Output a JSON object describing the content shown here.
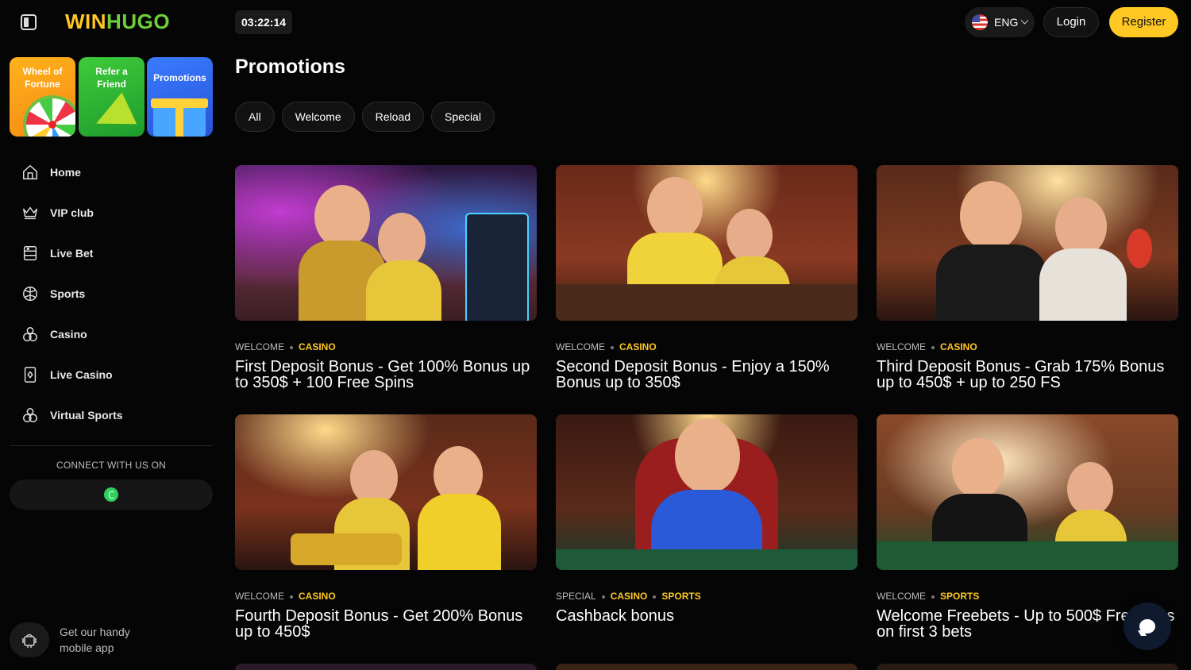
{
  "brand": {
    "logo_part1": "WIN",
    "logo_part2": "HUGO"
  },
  "header": {
    "clock": "03:22:14",
    "language": "ENG",
    "login_label": "Login",
    "register_label": "Register"
  },
  "colors": {
    "accent": "#ffc823",
    "brand_green": "#6fcf3a",
    "background": "#050505"
  },
  "sidebar": {
    "tiles": [
      {
        "label": "Wheel of Fortune",
        "icon": "wheel-icon"
      },
      {
        "label": "Refer a Friend",
        "icon": "megaphone-icon"
      },
      {
        "label": "Promotions",
        "icon": "gift-icon"
      }
    ],
    "items": [
      {
        "label": "Home",
        "icon": "home-icon"
      },
      {
        "label": "VIP club",
        "icon": "crown-icon"
      },
      {
        "label": "Live Bet",
        "icon": "live-bet-icon"
      },
      {
        "label": "Sports",
        "icon": "ball-icon"
      },
      {
        "label": "Casino",
        "icon": "dice-icon"
      },
      {
        "label": "Live Casino",
        "icon": "card-icon"
      },
      {
        "label": "Virtual Sports",
        "icon": "dice-icon"
      }
    ],
    "connect_label": "CONNECT WITH US ON",
    "social_icon": "whatsapp-icon",
    "app_promo": "Get our handy mobile app"
  },
  "main": {
    "title": "Promotions",
    "filters": [
      "All",
      "Welcome",
      "Reload",
      "Special"
    ],
    "promotions": [
      {
        "tags": [
          "WELCOME",
          "CASINO"
        ],
        "title": "First Deposit Bonus - Get 100% Bonus up to 350$ + 100 Free Spins"
      },
      {
        "tags": [
          "WELCOME",
          "CASINO"
        ],
        "title": "Second Deposit Bonus - Enjoy a 150% Bonus up to 350$"
      },
      {
        "tags": [
          "WELCOME",
          "CASINO"
        ],
        "title": "Third Deposit Bonus - Grab 175% Bonus up to 450$ + up to 250 FS"
      },
      {
        "tags": [
          "WELCOME",
          "CASINO"
        ],
        "title": "Fourth Deposit Bonus - Get 200% Bonus up to 450$"
      },
      {
        "tags": [
          "SPECIAL",
          "CASINO",
          "SPORTS"
        ],
        "title": "Cashback bonus"
      },
      {
        "tags": [
          "WELCOME",
          "SPORTS"
        ],
        "title": "Welcome Freebets - Up to 500$ Free Bets on first 3 bets"
      }
    ]
  },
  "chat_icon": "chat-icon"
}
